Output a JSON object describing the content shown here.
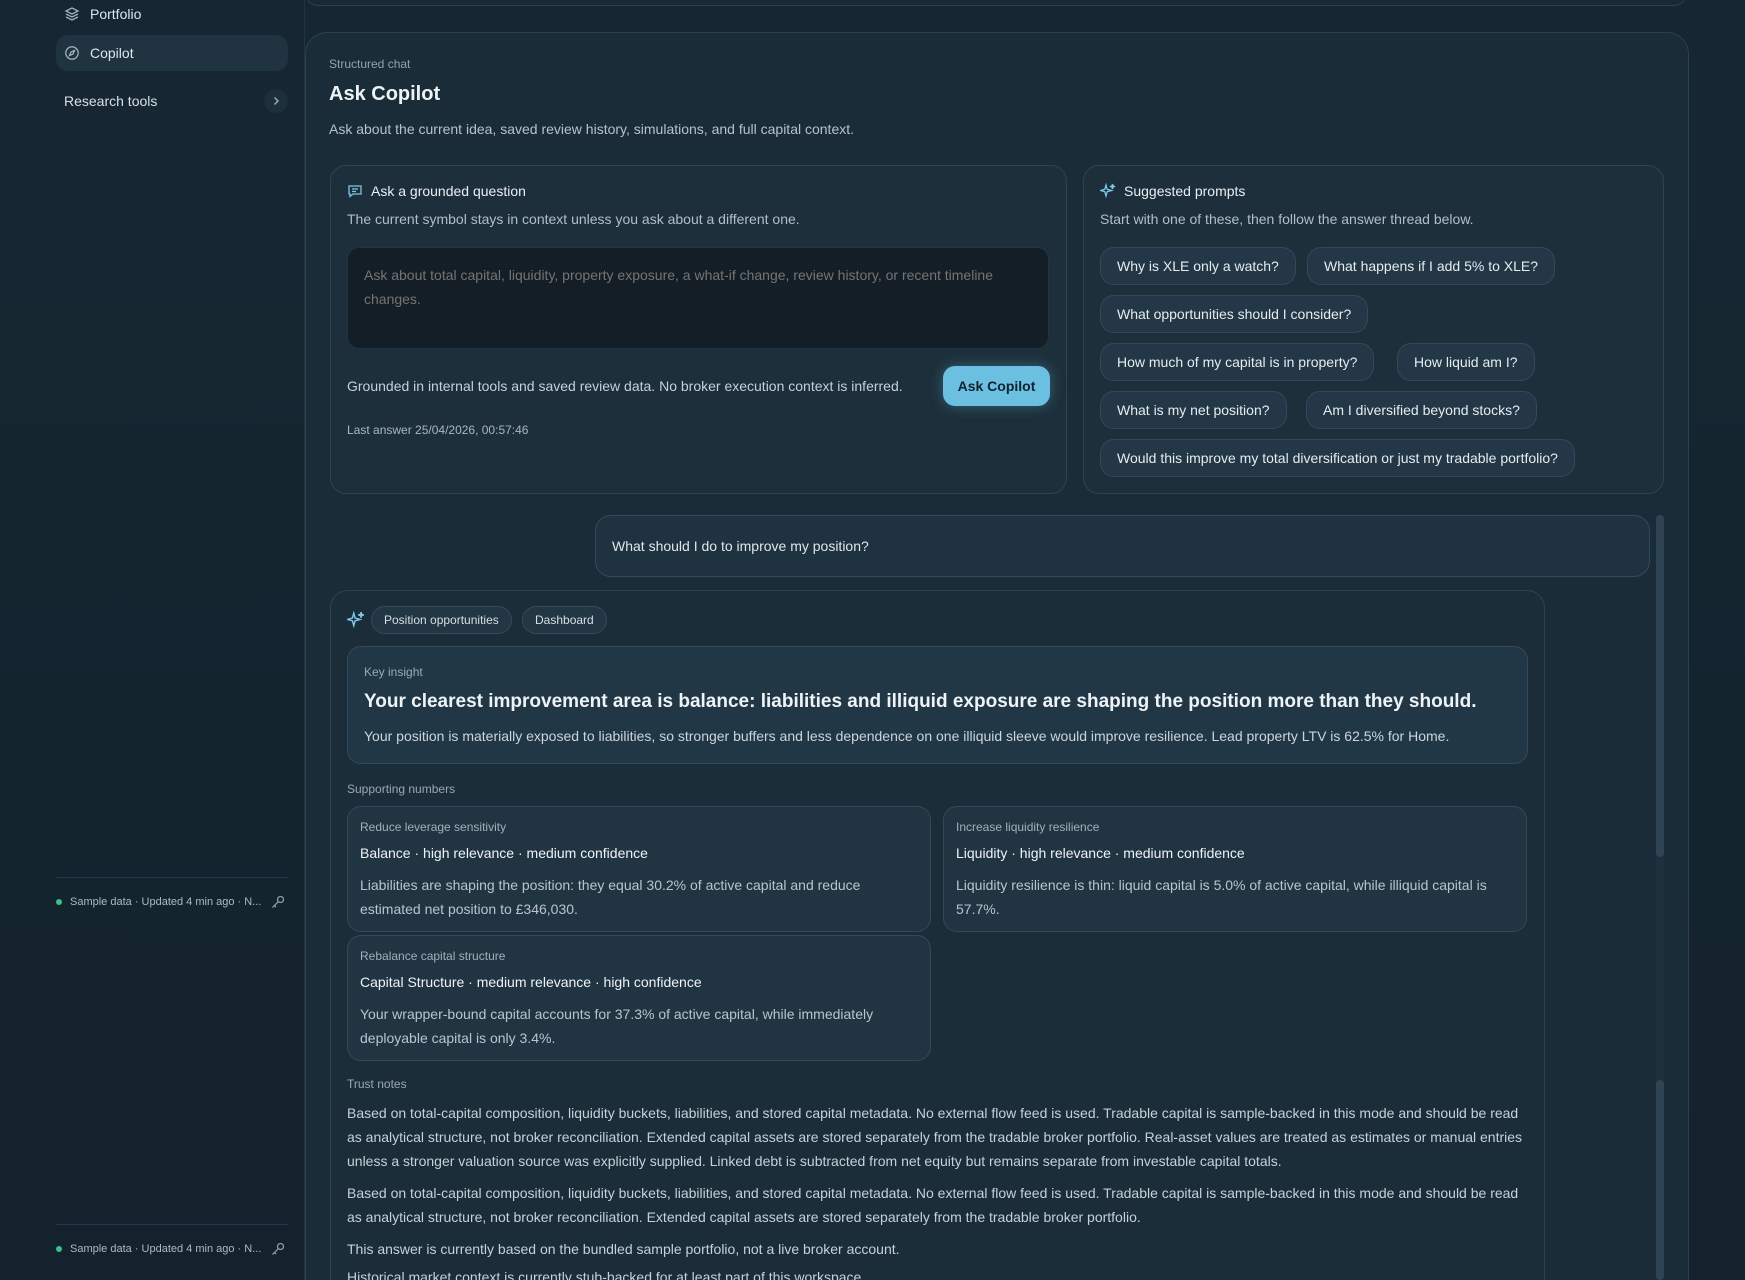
{
  "sidebar": {
    "items": [
      {
        "label": "Portfolio",
        "icon": "layers-icon"
      },
      {
        "label": "Copilot",
        "icon": "compass-icon",
        "active": true
      }
    ],
    "research_tools": "Research tools",
    "status_text": "Sample data · Updated 4 min ago · N..."
  },
  "page": {
    "eyebrow": "Structured chat",
    "title": "Ask Copilot",
    "subtitle": "Ask about the current idea, saved review history, simulations, and full capital context."
  },
  "ask_panel": {
    "title": "Ask a grounded question",
    "subtitle": "The current symbol stays in context unless you ask about a different one.",
    "placeholder": "Ask about total capital, liquidity, property exposure, a what-if change, review history, or recent timeline changes.",
    "grounded_note": "Grounded in internal tools and saved review data. No broker execution context is inferred.",
    "button_label": "Ask Copilot",
    "last_answer": "Last answer 25/04/2026, 00:57:46"
  },
  "prompts_panel": {
    "title": "Suggested prompts",
    "subtitle": "Start with one of these, then follow the answer thread below.",
    "chips": [
      "Why is XLE only a watch?",
      "What happens if I add 5% to XLE?",
      "What opportunities should I consider?",
      "How much of my capital is in property?",
      "How liquid am I?",
      "What is my net position?",
      "Am I diversified beyond stocks?",
      "Would this improve my total diversification or just my tradable portfolio?"
    ]
  },
  "thread": {
    "question": "What should I do to improve my position?",
    "tags": [
      "Position opportunities",
      "Dashboard"
    ],
    "insight": {
      "label": "Key insight",
      "headline": "Your clearest improvement area is balance: liabilities and illiquid exposure are shaping the position more than they should.",
      "body": "Your position is materially exposed to liabilities, so stronger buffers and less dependence on one illiquid sleeve would improve resilience. Lead property LTV is 62.5% for Home."
    },
    "supporting_label": "Supporting numbers",
    "cards": [
      {
        "label": "Reduce leverage sensitivity",
        "title": "Balance · high relevance · medium confidence",
        "desc": "Liabilities are shaping the position: they equal 30.2% of active capital and reduce estimated net position to £346,030."
      },
      {
        "label": "Increase liquidity resilience",
        "title": "Liquidity · high relevance · medium confidence",
        "desc": "Liquidity resilience is thin: liquid capital is 5.0% of active capital, while illiquid capital is 57.7%."
      },
      {
        "label": "Rebalance capital structure",
        "title": "Capital Structure · medium relevance · high confidence",
        "desc": "Your wrapper-bound capital accounts for 37.3% of active capital, while immediately deployable capital is only 3.4%."
      }
    ],
    "trust_label": "Trust notes",
    "trust_notes": [
      "Based on total-capital composition, liquidity buckets, liabilities, and stored capital metadata. No external flow feed is used. Tradable capital is sample-backed in this mode and should be read as analytical structure, not broker reconciliation. Extended capital assets are stored separately from the tradable broker portfolio. Real-asset values are treated as estimates or manual entries unless a stronger valuation source was explicitly supplied. Linked debt is subtracted from net equity but remains separate from investable capital totals.",
      "Based on total-capital composition, liquidity buckets, liabilities, and stored capital metadata. No external flow feed is used. Tradable capital is sample-backed in this mode and should be read as analytical structure, not broker reconciliation. Extended capital assets are stored separately from the tradable broker portfolio.",
      "This answer is currently based on the bundled sample portfolio, not a live broker account.",
      "Historical market context is currently stub-backed for at least part of this workspace."
    ]
  },
  "colors": {
    "accent": "#6bbfe0",
    "status_green": "#36c28a",
    "background": "#14222c"
  }
}
